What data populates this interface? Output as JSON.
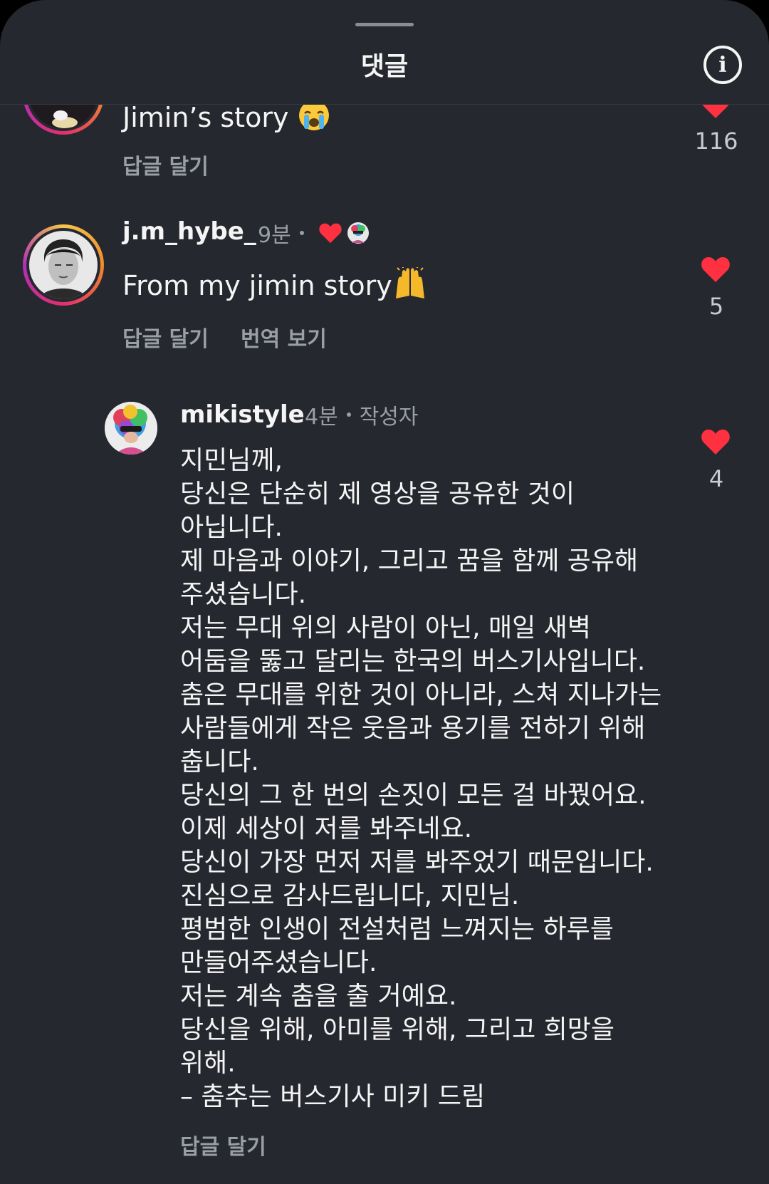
{
  "header": {
    "title": "댓글",
    "info_icon": "info-icon"
  },
  "comments": [
    {
      "text": "Jimin’s story",
      "emoji": "crying-face-icon",
      "reply_label": "답글 달기",
      "like_count": "116"
    },
    {
      "username": "j.m_hybe_",
      "time": "9분",
      "text": "From my jimin story",
      "emoji": "raising-hands-icon",
      "reply_label": "답글 달기",
      "translate_label": "번역 보기",
      "like_count": "5"
    },
    {
      "username": "mikistyle",
      "time": "4분",
      "author_badge": "작성자",
      "text": "지민님께,\n당신은 단순히 제 영상을 공유한 것이\n아닙니다.\n제 마음과 이야기, 그리고 꿈을 함께 공유해\n주셨습니다.\n저는 무대 위의 사람이 아닌, 매일 새벽\n어둠을 뚫고 달리는 한국의 버스기사입니다.\n춤은 무대를 위한 것이 아니라, 스쳐 지나가는\n사람들에게 작은 웃음과 용기를 전하기 위해\n춥니다.\n당신의 그 한 번의 손짓이 모든 걸 바꿨어요.\n이제 세상이 저를 봐주네요.\n당신이 가장 먼저 저를 봐주었기 때문입니다.\n진심으로 감사드립니다, 지민님.\n평범한 인생이 전설처럼 느껴지는 하루를\n만들어주셨습니다.\n저는 계속 춤을 출 거예요.\n당신을 위해, 아미를 위해, 그리고 희망을\n위해.\n– 춤추는 버스기사 미키 드림",
      "reply_label": "답글 달기",
      "like_count": "4"
    }
  ],
  "colors": {
    "background": "#25282e",
    "heart": "#ff3040",
    "muted": "#9a9ea5"
  }
}
